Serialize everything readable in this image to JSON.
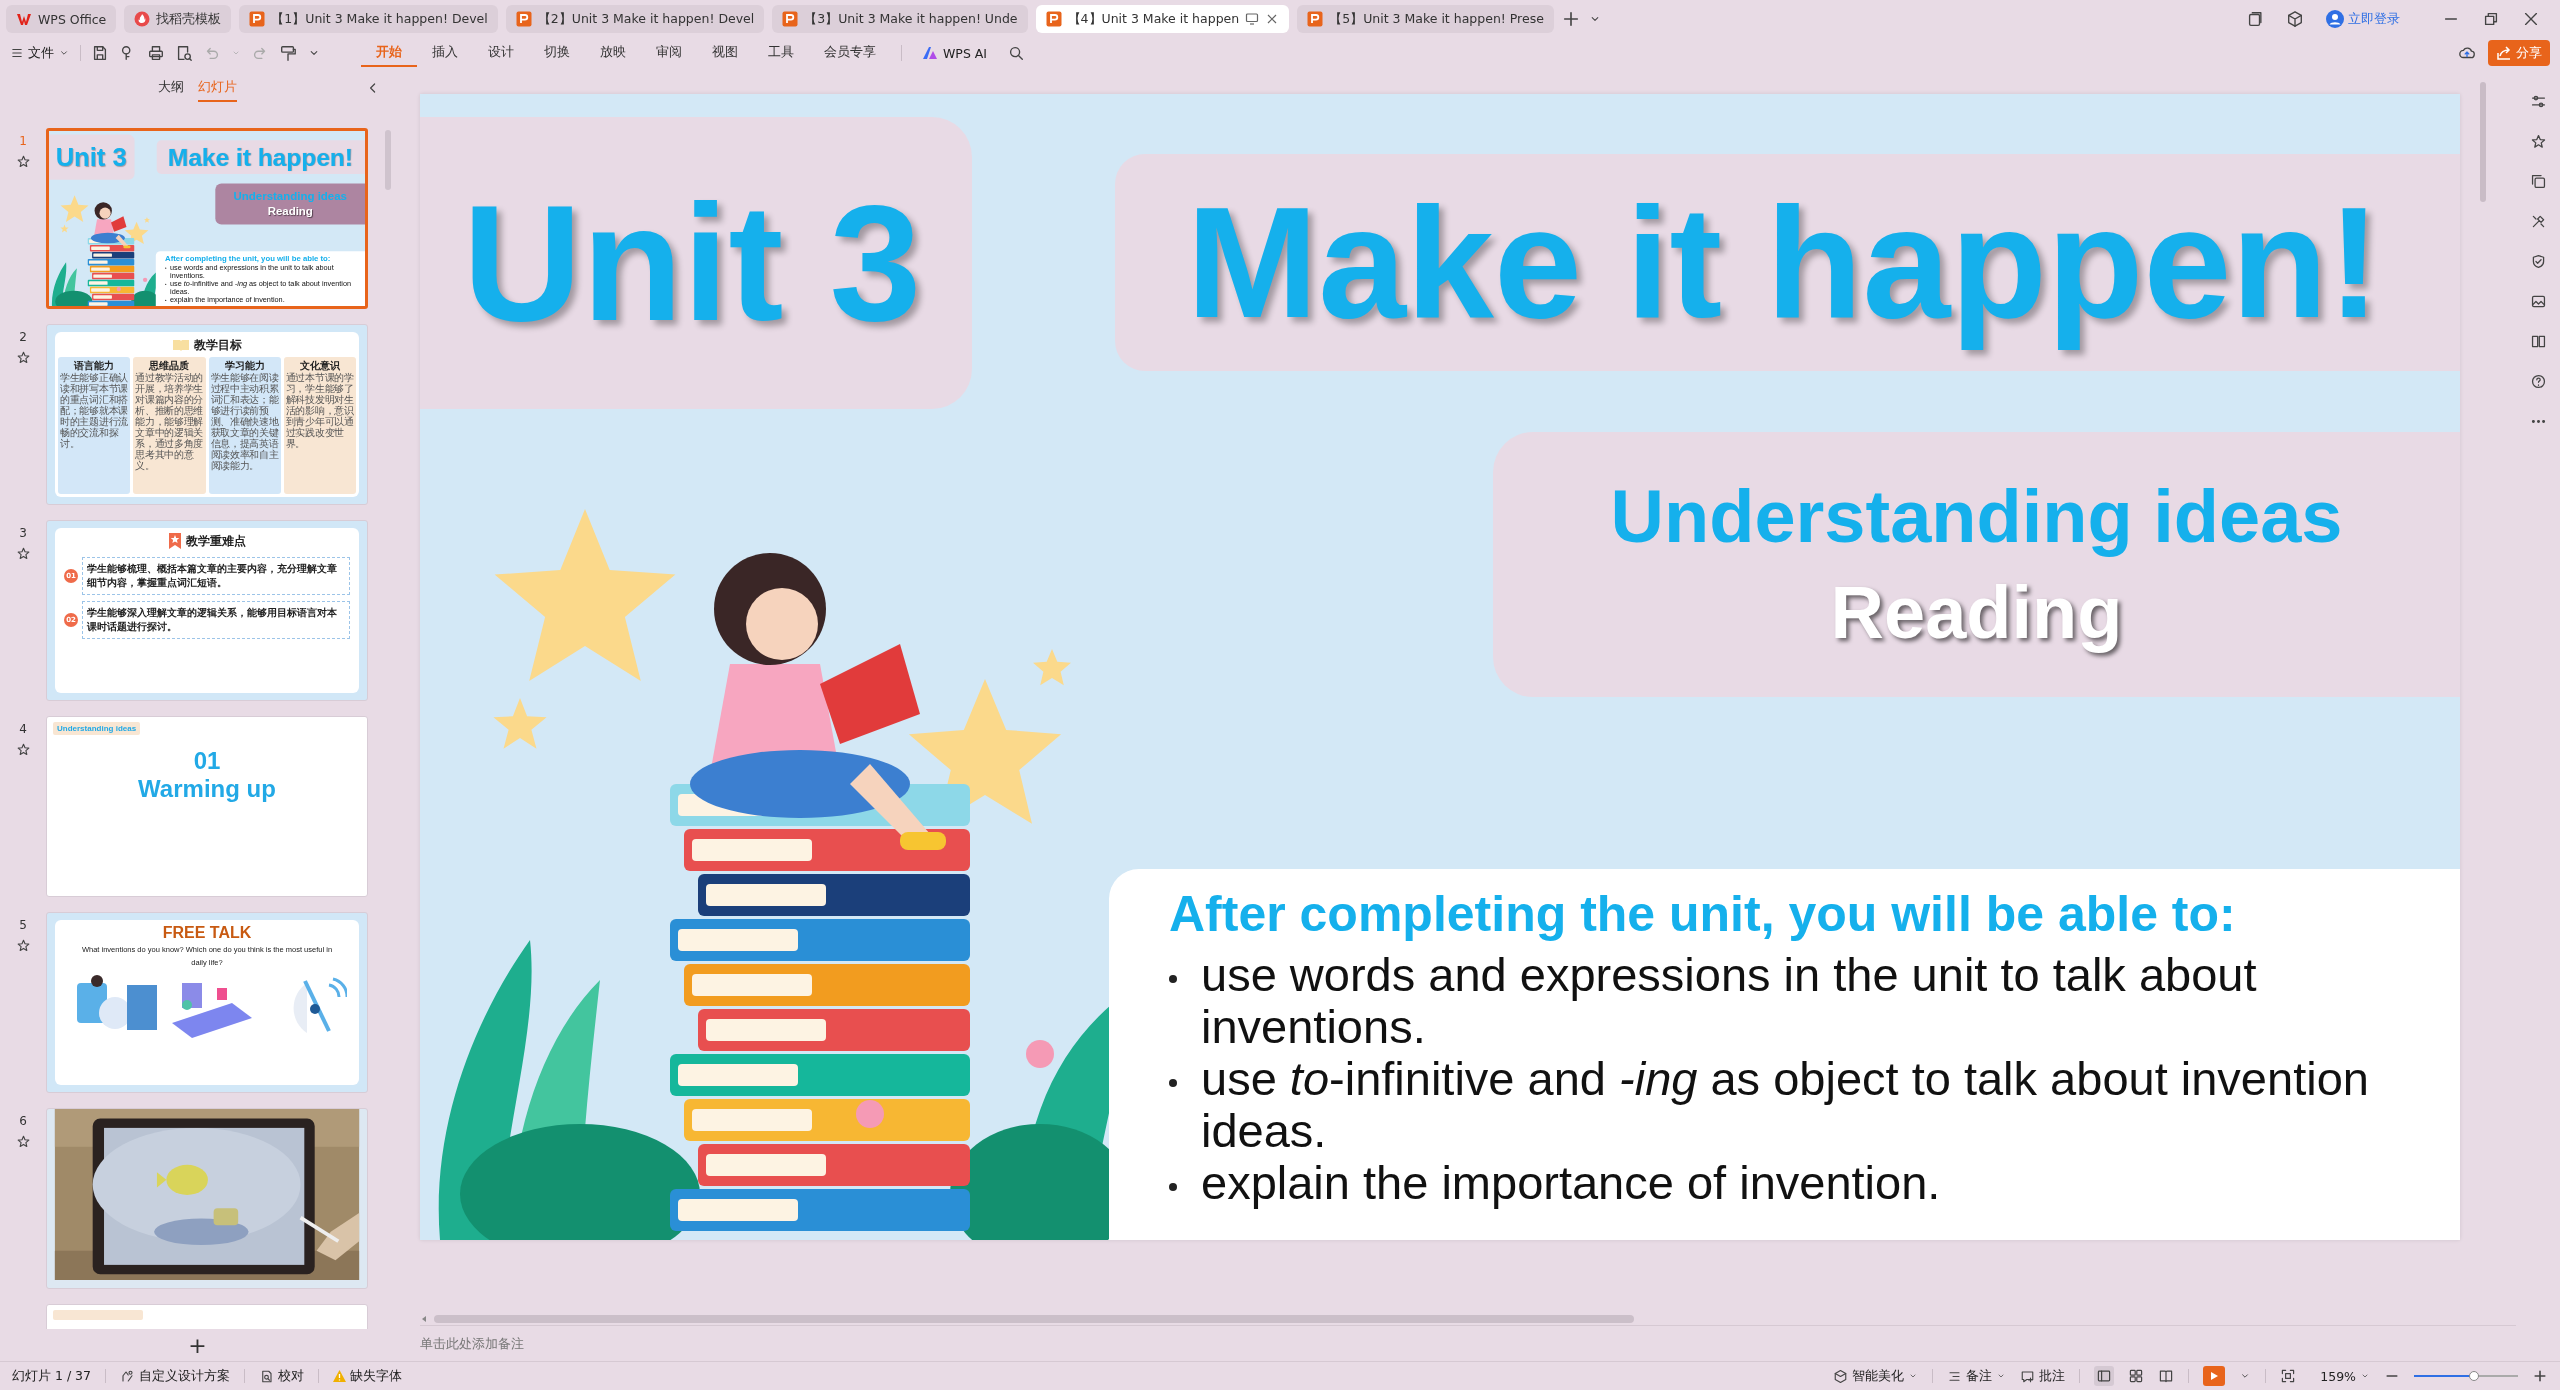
{
  "tabs": [
    {
      "kind": "wps",
      "label": "WPS Office",
      "selected": false
    },
    {
      "kind": "template",
      "label": "找稻壳模板",
      "selected": false
    },
    {
      "kind": "doc",
      "label": "【1】Unit 3 Make it happen! Devel",
      "selected": false
    },
    {
      "kind": "doc",
      "label": "【2】Unit 3 Make it happen! Devel",
      "selected": false
    },
    {
      "kind": "doc",
      "label": "【3】Unit 3 Make it happen! Unde",
      "selected": false
    },
    {
      "kind": "doc",
      "label": "【4】Unit 3 Make it happen",
      "selected": true
    },
    {
      "kind": "doc",
      "label": "【5】Unit 3 Make it happen! Prese",
      "selected": false
    }
  ],
  "account": {
    "login": "立即登录"
  },
  "toolbar": {
    "file": "文件",
    "menus": [
      {
        "label": "开始",
        "selected": true
      },
      {
        "label": "插入",
        "selected": false
      },
      {
        "label": "设计",
        "selected": false
      },
      {
        "label": "切换",
        "selected": false
      },
      {
        "label": "放映",
        "selected": false
      },
      {
        "label": "审阅",
        "selected": false
      },
      {
        "label": "视图",
        "selected": false
      },
      {
        "label": "工具",
        "selected": false
      },
      {
        "label": "会员专享",
        "selected": false
      }
    ],
    "ai": "WPS AI",
    "share": "分享"
  },
  "slide_panel": {
    "tabs": [
      {
        "label": "大纲",
        "selected": false
      },
      {
        "label": "幻灯片",
        "selected": true
      }
    ],
    "thumbnails": [
      {
        "kind": "title",
        "number": "1",
        "selected": true,
        "unit": "Unit 3",
        "title": "Make it happen!",
        "subtitle": "Understanding ideas",
        "section": "Reading",
        "goals_heading": "After completing the unit, you will be able to:",
        "goals": [
          "use words and expressions in the unit to talk about inventions.",
          "use *to*-infinitive and *-ing* as object to talk about invention ideas.",
          "explain the importance of invention."
        ]
      },
      {
        "kind": "objectives",
        "number": "2",
        "selected": false,
        "title": "教学目标",
        "columns": [
          {
            "heading": "语言能力",
            "text": "学生能够正确认读和拼写本节课的重点词汇和搭配；能够就本课时的主题进行流畅的交流和探讨。",
            "color": "#d3e7f8"
          },
          {
            "heading": "思维品质",
            "text": "通过教学活动的开展，培养学生对课篇内容的分析、推断的思维能力，能够理解文章中的逻辑关系，通过多角度思考其中的意义。",
            "color": "#f8e6d3"
          },
          {
            "heading": "学习能力",
            "text": "学生能够在阅读过程中主动积累词汇和表达；能够进行读前预测、准确快速地获取文章的关键信息，提高英语阅读效率和自主阅读能力。",
            "color": "#d3e7f8"
          },
          {
            "heading": "文化意识",
            "text": "通过本节课的学习，学生能够了解科技发明对生活的影响，意识到青少年可以通过实践改变世界。",
            "color": "#f8e6d3"
          }
        ]
      },
      {
        "kind": "key_points",
        "number": "3",
        "selected": false,
        "title": "教学重难点",
        "points": [
          {
            "badge": "01",
            "text": "学生能够梳理、概括本篇文章的主要内容，充分理解文章细节内容，掌握重点词汇短语。"
          },
          {
            "badge": "02",
            "text": "学生能够深入理解文章的逻辑关系，能够用目标语言对本课时话题进行探讨。"
          }
        ]
      },
      {
        "kind": "section",
        "number": "4",
        "selected": false,
        "tag": "Understanding ideas",
        "lines": [
          "01",
          "Warming up"
        ]
      },
      {
        "kind": "talk",
        "number": "5",
        "selected": false,
        "title": "FREE TALK",
        "question": "What inventions do you know? Which one do you think is the most useful in daily life?"
      },
      {
        "number": "6",
        "selected": false
      },
      {
        "kind": "partial",
        "selected": false
      }
    ],
    "add": "+"
  },
  "slide": {
    "kind": "title",
    "unit": "Unit 3",
    "title": "Make it happen!",
    "subtitle": "Understanding ideas",
    "section": "Reading",
    "goals_heading": "After completing the unit, you will be able to:",
    "goals": [
      "use words and expressions in the unit to talk about inventions.",
      "use *to*-infinitive and *-ing* as object to talk about invention ideas.",
      "explain the importance of invention."
    ]
  },
  "notes": {
    "placeholder": "单击此处添加备注"
  },
  "status_bar": {
    "slide": "幻灯片 1 / 37",
    "design": "自定义设计方案",
    "proof": "校对",
    "fonts": "缺失字体",
    "beautify": "智能美化",
    "notes": "备注",
    "comment": "批注",
    "zoom": "159%",
    "zoom_slider": {
      "level": 0.58
    }
  }
}
